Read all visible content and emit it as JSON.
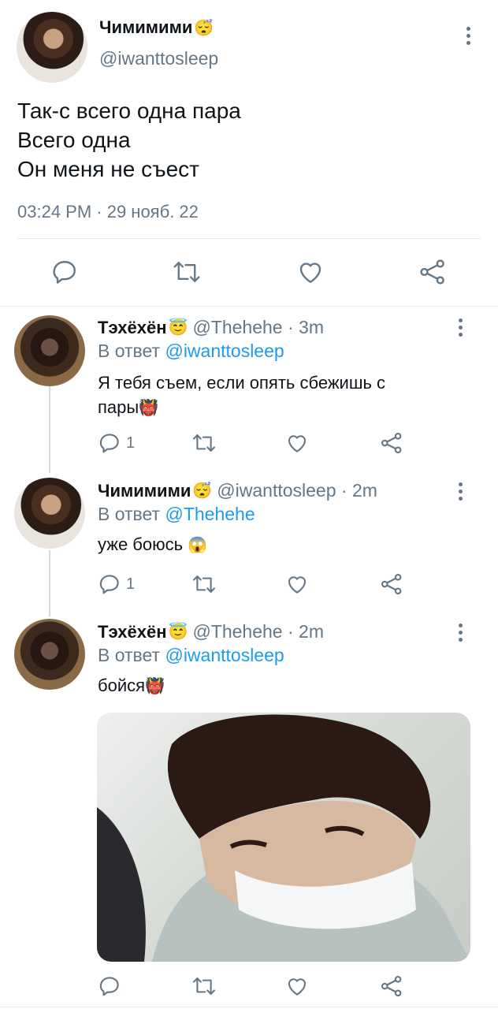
{
  "main_tweet": {
    "display_name": "Чимимими",
    "name_emoji": "😴",
    "handle": "@iwanttosleep",
    "text_lines": [
      "Так-с всего одна пара",
      "Всего одна",
      "Он меня не съест"
    ],
    "timestamp": "03:24 PM · 29 нояб. 22"
  },
  "replies": [
    {
      "display_name": "Тэхёхён",
      "name_emoji": "😇",
      "handle_time": "@Thehehe · 3m",
      "reply_prefix": "В ответ",
      "reply_to": "@iwanttosleep",
      "text_line1": "Я тебя съем, если опять сбежишь с",
      "text_line2": "пары",
      "text_emoji": "👹",
      "reply_count": "1"
    },
    {
      "display_name": "Чимимими",
      "name_emoji": "😴",
      "handle_time": "@iwanttosleep · 2m",
      "reply_prefix": "В ответ",
      "reply_to": "@Thehehe",
      "text_line1": "уже боюсь",
      "text_emoji": "😱",
      "reply_count": "1"
    },
    {
      "display_name": "Тэхёхён",
      "name_emoji": "😇",
      "handle_time": "@Thehehe · 2m",
      "reply_prefix": "В ответ",
      "reply_to": "@iwanttosleep",
      "text_line1": "бойся",
      "text_emoji": "👹"
    }
  ],
  "icons": {
    "reply": "reply-icon",
    "retweet": "retweet-icon",
    "like": "heart-icon",
    "share": "share-icon",
    "more": "more-vertical-icon"
  },
  "colors": {
    "link": "#1d9bf0",
    "secondary": "#657786",
    "text": "#0f1419",
    "divider": "#e6e9ec"
  }
}
